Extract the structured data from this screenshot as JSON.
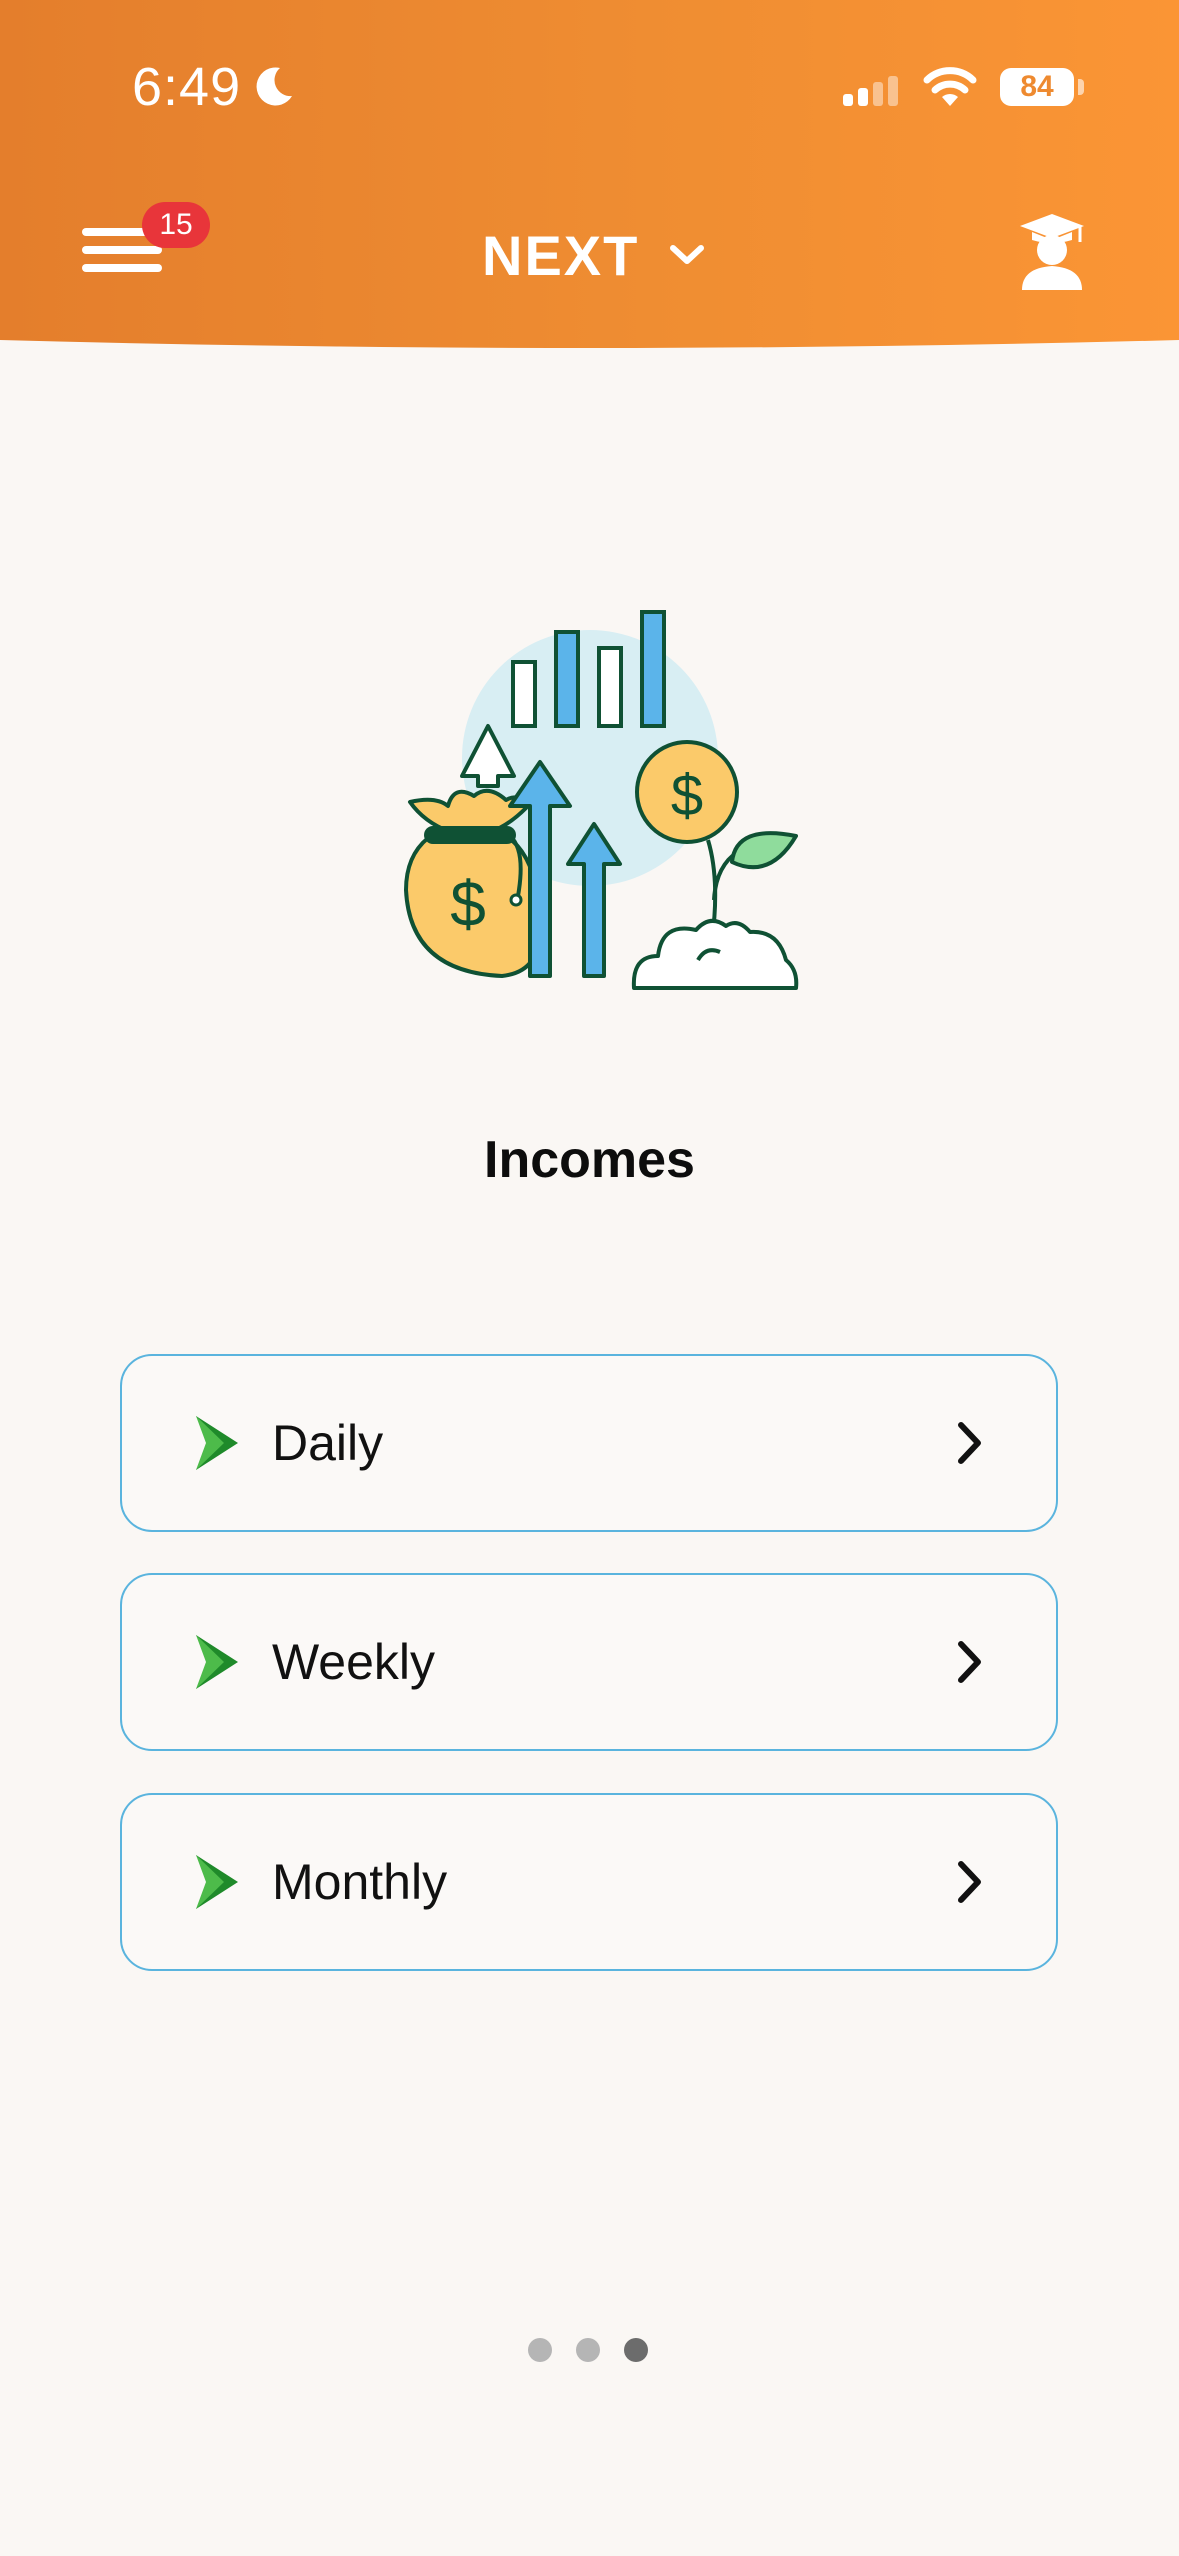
{
  "status_bar": {
    "time": "6:49",
    "battery": "84",
    "icons": [
      "moon-icon",
      "cellular-signal-icon",
      "wifi-icon",
      "battery-icon"
    ]
  },
  "header": {
    "notification_count": "15",
    "brand": "NEXT",
    "icons": [
      "hamburger-menu-icon",
      "chevron-down-icon",
      "student-profile-icon"
    ],
    "colors": {
      "gradient_start": "#e47e2c",
      "gradient_end": "#fb9535"
    }
  },
  "main": {
    "illustration": "money-growth-illustration",
    "title": "Incomes",
    "options": [
      {
        "label": "Daily"
      },
      {
        "label": "Weekly"
      },
      {
        "label": "Monthly"
      }
    ],
    "accent": "#5ab4de",
    "arrow_color": "#1f8a2a"
  },
  "pager": {
    "total": 3,
    "current": 3
  }
}
